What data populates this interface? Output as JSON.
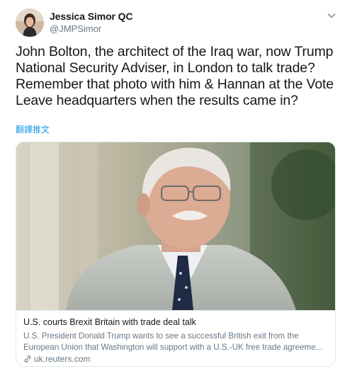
{
  "author": {
    "name": "Jessica Simor QC",
    "handle": "@JMPSimor",
    "avatar_icon": "profile-photo"
  },
  "tweet": {
    "text": "John Bolton, the architect of the Iraq war, now Trump\nNational Security Adviser, in London to talk trade?\nRemember that photo with him & Hannan at the Vote\nLeave headquarters when the results came in?",
    "translate_label": "翻譯推文",
    "menu_icon": "chevron-down-icon"
  },
  "card": {
    "image_alt": "John Bolton photo",
    "title": "U.S. courts Brexit Britain with trade deal talk",
    "description": "U.S. President Donald Trump wants to see a successful British exit from the\nEuropean Union that Washington will support with a U.S.-UK free trade agreeme...",
    "domain": "uk.reuters.com",
    "domain_icon": "link-icon"
  },
  "colors": {
    "link": "#1b95e0",
    "secondary_text": "#657786",
    "border": "#e1e8ed"
  }
}
